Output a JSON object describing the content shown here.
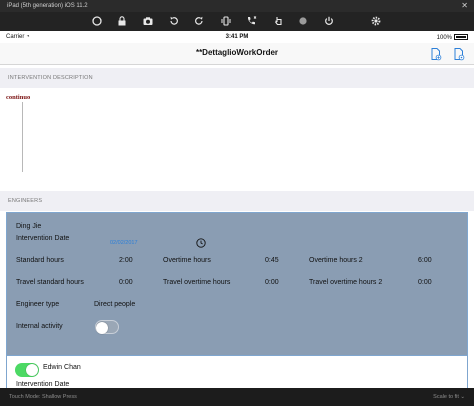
{
  "window": {
    "title": "iPad (5th generation) iOS 11.2",
    "close_glyph": "✕"
  },
  "toolbar": {
    "icons": [
      "home-icon",
      "lock-icon",
      "camera-icon",
      "rotate-left-icon",
      "rotate-right-icon",
      "shake-icon",
      "call-icon",
      "touch-icon",
      "record-icon",
      "power-icon",
      "settings-icon"
    ]
  },
  "statusbar": {
    "carrier": "Carrier",
    "time": "3:41 PM",
    "battery": "100%"
  },
  "navbar": {
    "title": "**DettaglioWorkOrder"
  },
  "sections": {
    "description_header": "INTERVENTION DESCRIPTION",
    "description_text": "continuo",
    "engineers_header": "ENGINEERS"
  },
  "engineers": [
    {
      "name": "Ding Jie",
      "intervention_date_label": "Intervention Date",
      "intervention_date": "02/02/2017",
      "standard_hours_label": "Standard hours",
      "standard_hours": "2:00",
      "overtime_hours_label": "Overtime hours",
      "overtime_hours": "0:45",
      "overtime_hours_2_label": "Overtime hours 2",
      "overtime_hours_2": "6:00",
      "travel_standard_label": "Travel standard hours",
      "travel_standard": "0:00",
      "travel_overtime_label": "Travel overtime hours",
      "travel_overtime": "0:00",
      "travel_overtime_2_label": "Travel overtime hours 2",
      "travel_overtime_2": "0:00",
      "engineer_type_label": "Engineer type",
      "engineer_type": "Direct people",
      "internal_activity_label": "Internal activity",
      "internal_activity": false
    },
    {
      "name": "Edwin Chan",
      "intervention_date_label": "Intervention Date",
      "internal_activity": true
    }
  ],
  "footer": {
    "left": "Touch Mode: Shallow Press",
    "right": "Scale to fit ⌄"
  },
  "colors": {
    "card_selected_bg": "#8a9db3",
    "card_border": "#7fa6cf",
    "toggle_on": "#4cd964",
    "link_blue": "#2c7fd8"
  }
}
